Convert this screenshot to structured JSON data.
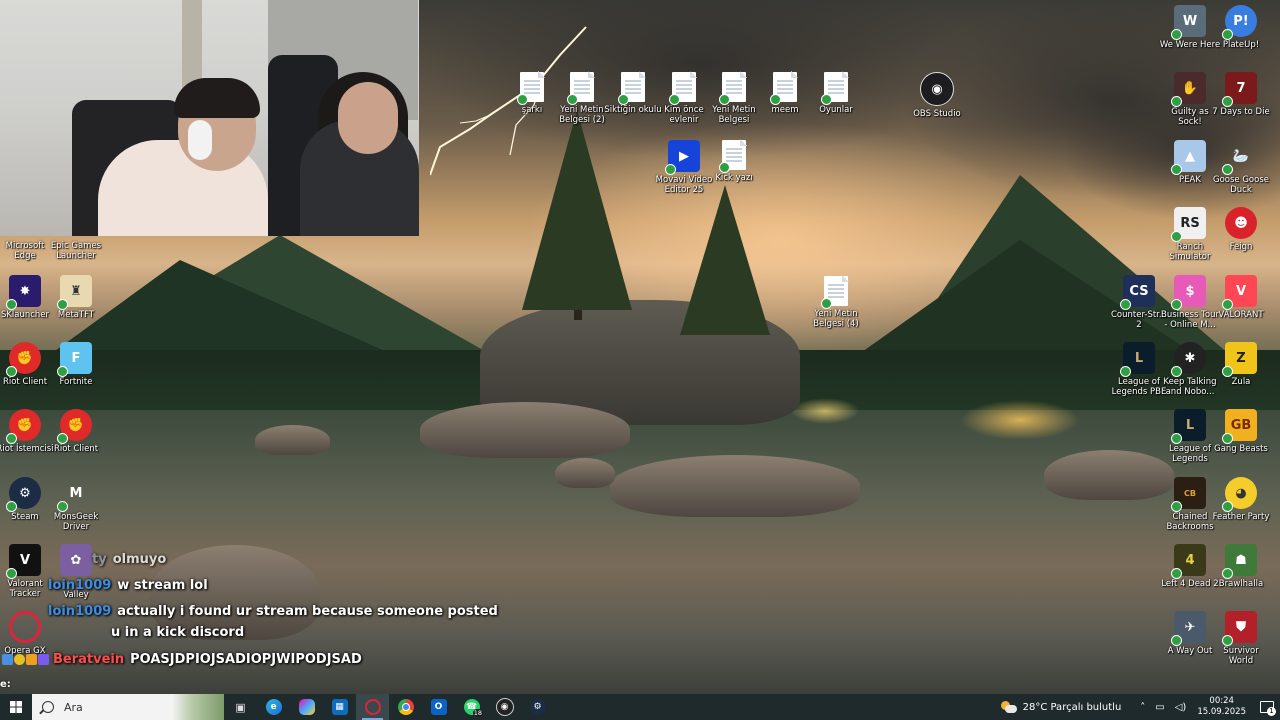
{
  "webcam": {
    "visible": true
  },
  "desktop_icons_top": [
    {
      "label": "şarkı",
      "type": "doc"
    },
    {
      "label": "Yeni Metin Belgesi (2)",
      "type": "doc"
    },
    {
      "label": "Siktiğin okulu",
      "type": "doc"
    },
    {
      "label": "Kim önce evlenir",
      "type": "doc"
    },
    {
      "label": "Yeni Metin Belgesi",
      "type": "doc"
    },
    {
      "label": "meem",
      "type": "doc"
    },
    {
      "label": "Oyunlar",
      "type": "doc"
    },
    {
      "label": "OBS Studio",
      "type": "app"
    },
    {
      "label": "Movavi Video Editor 25",
      "type": "app"
    },
    {
      "label": "Kick yazı",
      "type": "doc"
    },
    {
      "label": "Yeni Metin Belgesi (4)",
      "type": "doc"
    }
  ],
  "desktop_icons_left": [
    {
      "label": "Microsoft Edge"
    },
    {
      "label": "Epic Games Launcher"
    },
    {
      "label": "SKlauncher"
    },
    {
      "label": "MetaTFT"
    },
    {
      "label": "Riot Client"
    },
    {
      "label": "Fortnite"
    },
    {
      "label": "Riot İstemcisi"
    },
    {
      "label": "Riot Client"
    },
    {
      "label": "Steam"
    },
    {
      "label": "MonsGeek Driver"
    },
    {
      "label": "Valorant Tracker"
    },
    {
      "label": "Valley"
    },
    {
      "label": "Opera GX"
    }
  ],
  "desktop_icons_right": [
    {
      "label": "We Were Here"
    },
    {
      "label": "PlateUp!"
    },
    {
      "label": "Guilty as Sock!"
    },
    {
      "label": "7 Days to Die"
    },
    {
      "label": "PEAK"
    },
    {
      "label": "Goose Goose Duck"
    },
    {
      "label": "Ranch Simulator"
    },
    {
      "label": "Feign"
    },
    {
      "label": "Counter-Str... 2"
    },
    {
      "label": "Business Tour - Online M..."
    },
    {
      "label": "VALORANT"
    },
    {
      "label": "League of Legends PBE"
    },
    {
      "label": "Keep Talking and Nobo..."
    },
    {
      "label": "Zula"
    },
    {
      "label": "League of Legends"
    },
    {
      "label": "Gang Beasts"
    },
    {
      "label": "Chained Backrooms"
    },
    {
      "label": "Feather Party"
    },
    {
      "label": "Left 4 Dead 2"
    },
    {
      "label": "Brawlhalla"
    },
    {
      "label": "A Way Out"
    },
    {
      "label": "Survivor World"
    }
  ],
  "chat": [
    {
      "user": "ty",
      "message": "olmuyo"
    },
    {
      "user": "loin1009",
      "message": "w stream lol"
    },
    {
      "user": "loin1009",
      "message": "actually i found ur stream because someone posted"
    },
    {
      "user": "",
      "message": "u in a kick discord"
    },
    {
      "user": "Beratvein",
      "message": "POASJDPIOJSADIOPJWIPODJSAD"
    }
  ],
  "prompt_text": "e:",
  "taskbar": {
    "search_placeholder": "Ara",
    "apps": [
      {
        "name": "task-view",
        "glyph": "▣"
      },
      {
        "name": "edge",
        "glyph": "e"
      },
      {
        "name": "copilot",
        "glyph": "◆"
      },
      {
        "name": "store",
        "glyph": "▦"
      },
      {
        "name": "opera-gx",
        "glyph": "O"
      },
      {
        "name": "chrome",
        "glyph": "●"
      },
      {
        "name": "outlook",
        "glyph": "O"
      },
      {
        "name": "whatsapp",
        "glyph": "☎",
        "count": "18"
      },
      {
        "name": "obs-studio",
        "glyph": "◉"
      },
      {
        "name": "steam",
        "glyph": "S"
      }
    ],
    "weather_text": "28°C  Parçalı bulutlu",
    "time": "00:24",
    "date": "15.09.2025",
    "notification_count": "1"
  },
  "colors": {
    "taskbar": "#1f2a2d",
    "chat_user": "#3a8ee6",
    "chat_user_red": "#ff4d4d",
    "check": "#2ea043"
  }
}
